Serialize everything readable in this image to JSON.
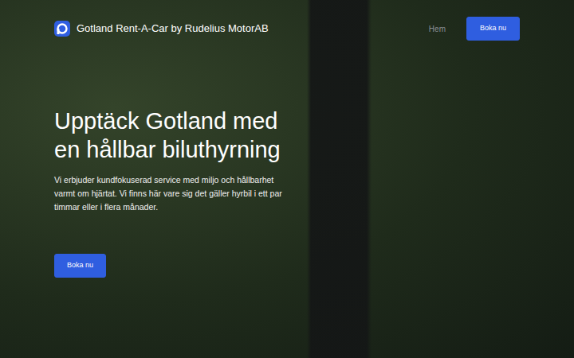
{
  "navbar": {
    "brand": "Gotland Rent-A-Car by Rudelius MotorAB",
    "links": [
      {
        "label": "Hem",
        "selected": false
      }
    ],
    "cta": "Boka nu"
  },
  "hero": {
    "title": "Upptäck Gotland med en hållbar biluthyrning",
    "text": "Vi erbjuder kundfokuserad service med miljo och hållbarhet varmt om hjärtat. Vi finns här vare sig det gäller hyrbil i ett par timmar eller i flera månader.",
    "button": "Boka nu"
  }
}
